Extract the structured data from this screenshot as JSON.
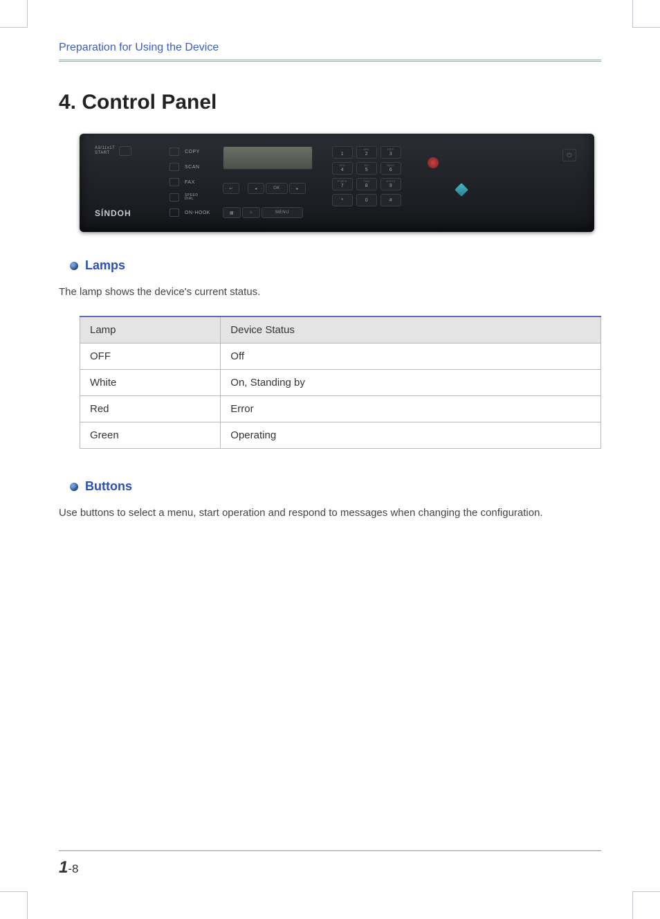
{
  "header": {
    "breadcrumb": "Preparation for Using the Device"
  },
  "title": "4. Control Panel",
  "panel": {
    "id_start": "A3/11x17\nSTART",
    "brand": "SÍNDOH",
    "modes": [
      "COPY",
      "SCAN",
      "FAX",
      "SPEED\nDIAL",
      "ON-HOOK"
    ],
    "nav": {
      "back": "↩",
      "left": "◂",
      "ok": "OK",
      "right": "▸"
    },
    "bottom": {
      "book": "▦",
      "home": "⌂",
      "menu": "MENU"
    },
    "keys": [
      {
        "sup": ".",
        "num": "1"
      },
      {
        "sup": "ABC",
        "num": "2"
      },
      {
        "sup": "DEF",
        "num": "3"
      },
      {
        "sup": "GHI",
        "num": "4"
      },
      {
        "sup": "JKL",
        "num": "5"
      },
      {
        "sup": "MNO",
        "num": "6"
      },
      {
        "sup": "PQRS",
        "num": "7"
      },
      {
        "sup": "TUV",
        "num": "8"
      },
      {
        "sup": "WXYZ",
        "num": "9"
      },
      {
        "sup": "",
        "num": "*"
      },
      {
        "sup": "",
        "num": "0"
      },
      {
        "sup": "",
        "num": "#"
      }
    ],
    "power": "⏻"
  },
  "lamps": {
    "title": "Lamps",
    "desc": "The lamp shows the device's current status.",
    "headers": [
      "Lamp",
      "Device Status"
    ],
    "rows": [
      [
        "OFF",
        "Off"
      ],
      [
        "White",
        "On, Standing by"
      ],
      [
        "Red",
        "Error"
      ],
      [
        "Green",
        "Operating"
      ]
    ]
  },
  "buttons": {
    "title": "Buttons",
    "desc": "Use buttons to select a menu, start operation and respond to messages when changing the configuration."
  },
  "page_number": {
    "chapter": "1",
    "page": "-8"
  }
}
